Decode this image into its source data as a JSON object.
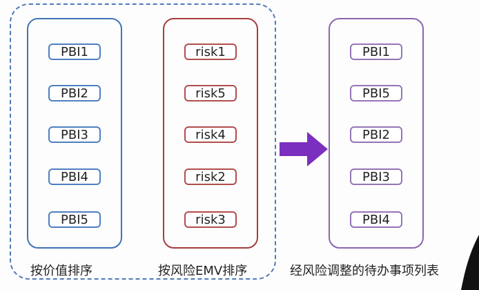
{
  "left_column": {
    "items": [
      "PBI1",
      "PBI2",
      "PBI3",
      "PBI4",
      "PBI5"
    ],
    "caption": "按价值排序",
    "border_color": "#3f73b5"
  },
  "middle_column": {
    "items": [
      "risk1",
      "risk5",
      "risk4",
      "risk2",
      "risk3"
    ],
    "caption": "按风险EMV排序",
    "border_color": "#a53b3b"
  },
  "right_column": {
    "items": [
      "PBI1",
      "PBI5",
      "PBI2",
      "PBI3",
      "PBI4"
    ],
    "caption": "经风险调整的待办事项列表",
    "border_color": "#8a65ad"
  },
  "group_outline_color": "#4f79b8",
  "arrow": {
    "icon": "arrow-right-icon",
    "color": "#7b2fbe"
  }
}
